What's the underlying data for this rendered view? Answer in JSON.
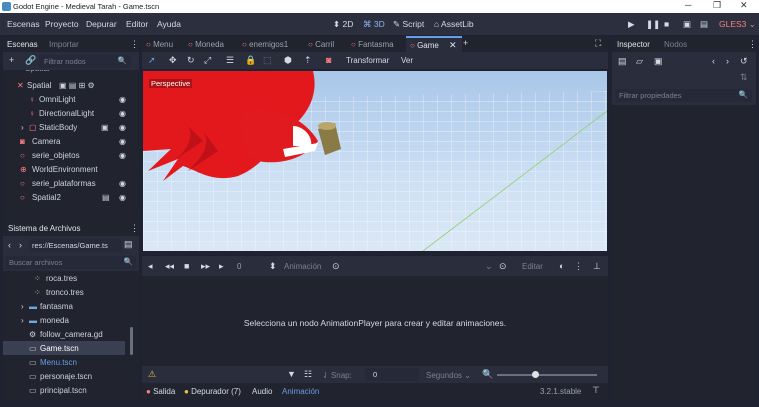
{
  "window": {
    "title": "Godot Engine - Medieval Tarah - Game.tscn"
  },
  "menu": {
    "items": [
      "Escenas",
      "Proyecto",
      "Depurar",
      "Editor",
      "Ayuda"
    ]
  },
  "modes": {
    "m2d": "2D",
    "m3d": "3D",
    "script": "Script",
    "assetlib": "AssetLib"
  },
  "renderer": "GLES3",
  "scene_dock": {
    "tabs": [
      "Escenas",
      "Importar"
    ],
    "filter_placeholder": "Filtrar nodos",
    "nodes": [
      {
        "label": "Spatial",
        "depth": 0
      },
      {
        "label": "OmniLight",
        "depth": 1
      },
      {
        "label": "DirectionalLight",
        "depth": 1
      },
      {
        "label": "StaticBody",
        "depth": 1
      },
      {
        "label": "Camera",
        "depth": 0
      },
      {
        "label": "serie_objetos",
        "depth": 0
      },
      {
        "label": "WorldEnvironment",
        "depth": 0
      },
      {
        "label": "serie_plataformas",
        "depth": 0
      },
      {
        "label": "Spatial2",
        "depth": 0
      }
    ]
  },
  "fs_dock": {
    "title": "Sistema de Archivos",
    "path": "res://Escenas/Game.ts",
    "search_placeholder": "Buscar archivos",
    "files": [
      "roca.tres",
      "tronco.tres",
      "fantasma",
      "moneda",
      "follow_camera.gd",
      "Game.tscn",
      "Menu.tscn",
      "personaje.tscn",
      "principal.tscn"
    ]
  },
  "scene_tabs": [
    "Menu",
    "Moneda",
    "enemigos1",
    "Carril",
    "Fantasma",
    "Game"
  ],
  "viewport": {
    "toolbar_transform": "Transformar",
    "toolbar_view": "Ver",
    "perspective": "Perspective"
  },
  "anim": {
    "frame_value": "0",
    "animation_label": "Animación",
    "edit_label": "Editar",
    "message": "Selecciona un nodo AnimationPlayer para crear y editar animaciones.",
    "snap_label": "Snap:",
    "snap_value": "0",
    "unit": "Segundos"
  },
  "bottom_tabs": {
    "output": "Salida",
    "debugger": "Depurador (7)",
    "audio": "Audio",
    "animation": "Animación",
    "version": "3.2.1.stable"
  },
  "inspector": {
    "tabs": [
      "Inspector",
      "Nodos"
    ],
    "filter_placeholder": "Filtrar propiedades"
  },
  "colors": {
    "accent": "#699ce8",
    "bg": "#1f2231",
    "panel": "#2a2d3c",
    "node_red": "#fc7f7f",
    "node_green": "#a5efac"
  }
}
